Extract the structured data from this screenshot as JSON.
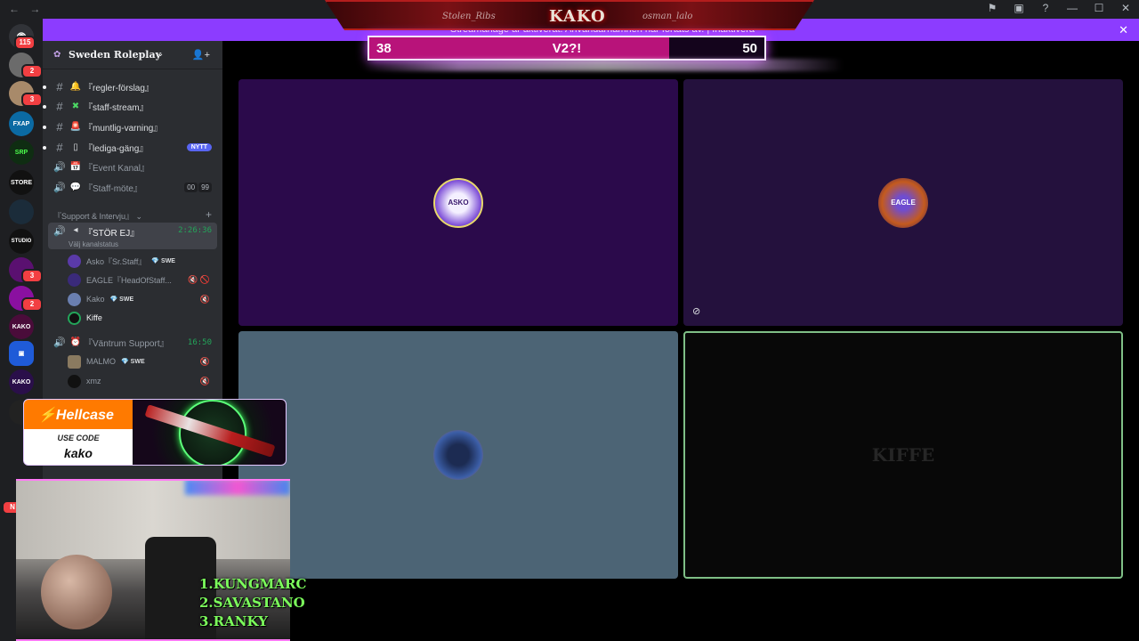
{
  "titlebar": {
    "back": "←",
    "forward": "→",
    "icons": [
      "flag-icon",
      "inbox-icon",
      "help-icon"
    ],
    "minimize": "—",
    "maximize": "☐",
    "close": "✕"
  },
  "banner": {
    "left_name": "Stolen_Ribs",
    "logo": "KAKO",
    "right_name": "osman_lalo"
  },
  "notice": {
    "text": "Streamarläge är aktiverat. Användarnamnen har förtäts av.  |  Inaktivera",
    "close": "✕"
  },
  "score": {
    "left": "38",
    "middle": "V2?!",
    "right": "50",
    "progress": 0.76,
    "colors": {
      "fill": "#b8137a",
      "border": "#f3e8ff"
    }
  },
  "rail": {
    "top_badge": "115",
    "badges": [
      "2",
      "3",
      "3",
      "2"
    ],
    "mention_badge": "N"
  },
  "server": {
    "name": "Sweden Roleplay",
    "chevron": "⌄"
  },
  "channels": [
    {
      "type": "text",
      "emoji": "🔔",
      "label": "『regler-förslag』"
    },
    {
      "type": "text",
      "emoji": "✖",
      "label": "『staff-stream』"
    },
    {
      "type": "text",
      "emoji": "🚨",
      "label": "『muntlig-varning』"
    },
    {
      "type": "text",
      "emoji": "▯",
      "label": "『lediga-gäng』",
      "badge": "NYTT"
    },
    {
      "type": "voice",
      "emoji": "📅",
      "label": "『Event Kanal』"
    },
    {
      "type": "voice",
      "emoji": "💬",
      "label": "『Staff-möte』",
      "pill": [
        "00",
        "99"
      ]
    }
  ],
  "category": {
    "label": "『Support & Intervju』",
    "add": "+"
  },
  "active_voice": {
    "label": "『STÖR EJ』",
    "timer": "2:26:36",
    "status": "Välj kanalstatus"
  },
  "users_stor_ej": [
    {
      "name": "Asko『Sr.Staff』",
      "tag": "💎 SWE",
      "mute": ""
    },
    {
      "name": "EAGLE『HeadOfStaff...",
      "tag": "",
      "mute": "🔇 🚫"
    },
    {
      "name": "Kako",
      "tag": "💎 SWE",
      "mute": "🔇"
    },
    {
      "name": "Kiffe",
      "tag": "",
      "mute": ""
    }
  ],
  "vantrum": {
    "label": "『Väntrum Support』",
    "timer": "16:50"
  },
  "users_vantrum": [
    {
      "name": "MALMO",
      "tag": "💎 SWE",
      "mute": "🔇"
    },
    {
      "name": "xmz",
      "tag": "",
      "mute": "🔇"
    }
  ],
  "tiles": {
    "t1_avatar": "ASKO",
    "t2_avatar": "EAGLE",
    "t4_name": "KIFFE",
    "hidden_cam_icon": "⊘"
  },
  "ad": {
    "brand": "Hellcase",
    "use_code": "USE CODE",
    "code": "kako"
  },
  "leaderboard": [
    "1.KUNGMARC",
    "2.SAVASTANO",
    "3.RANKY"
  ]
}
